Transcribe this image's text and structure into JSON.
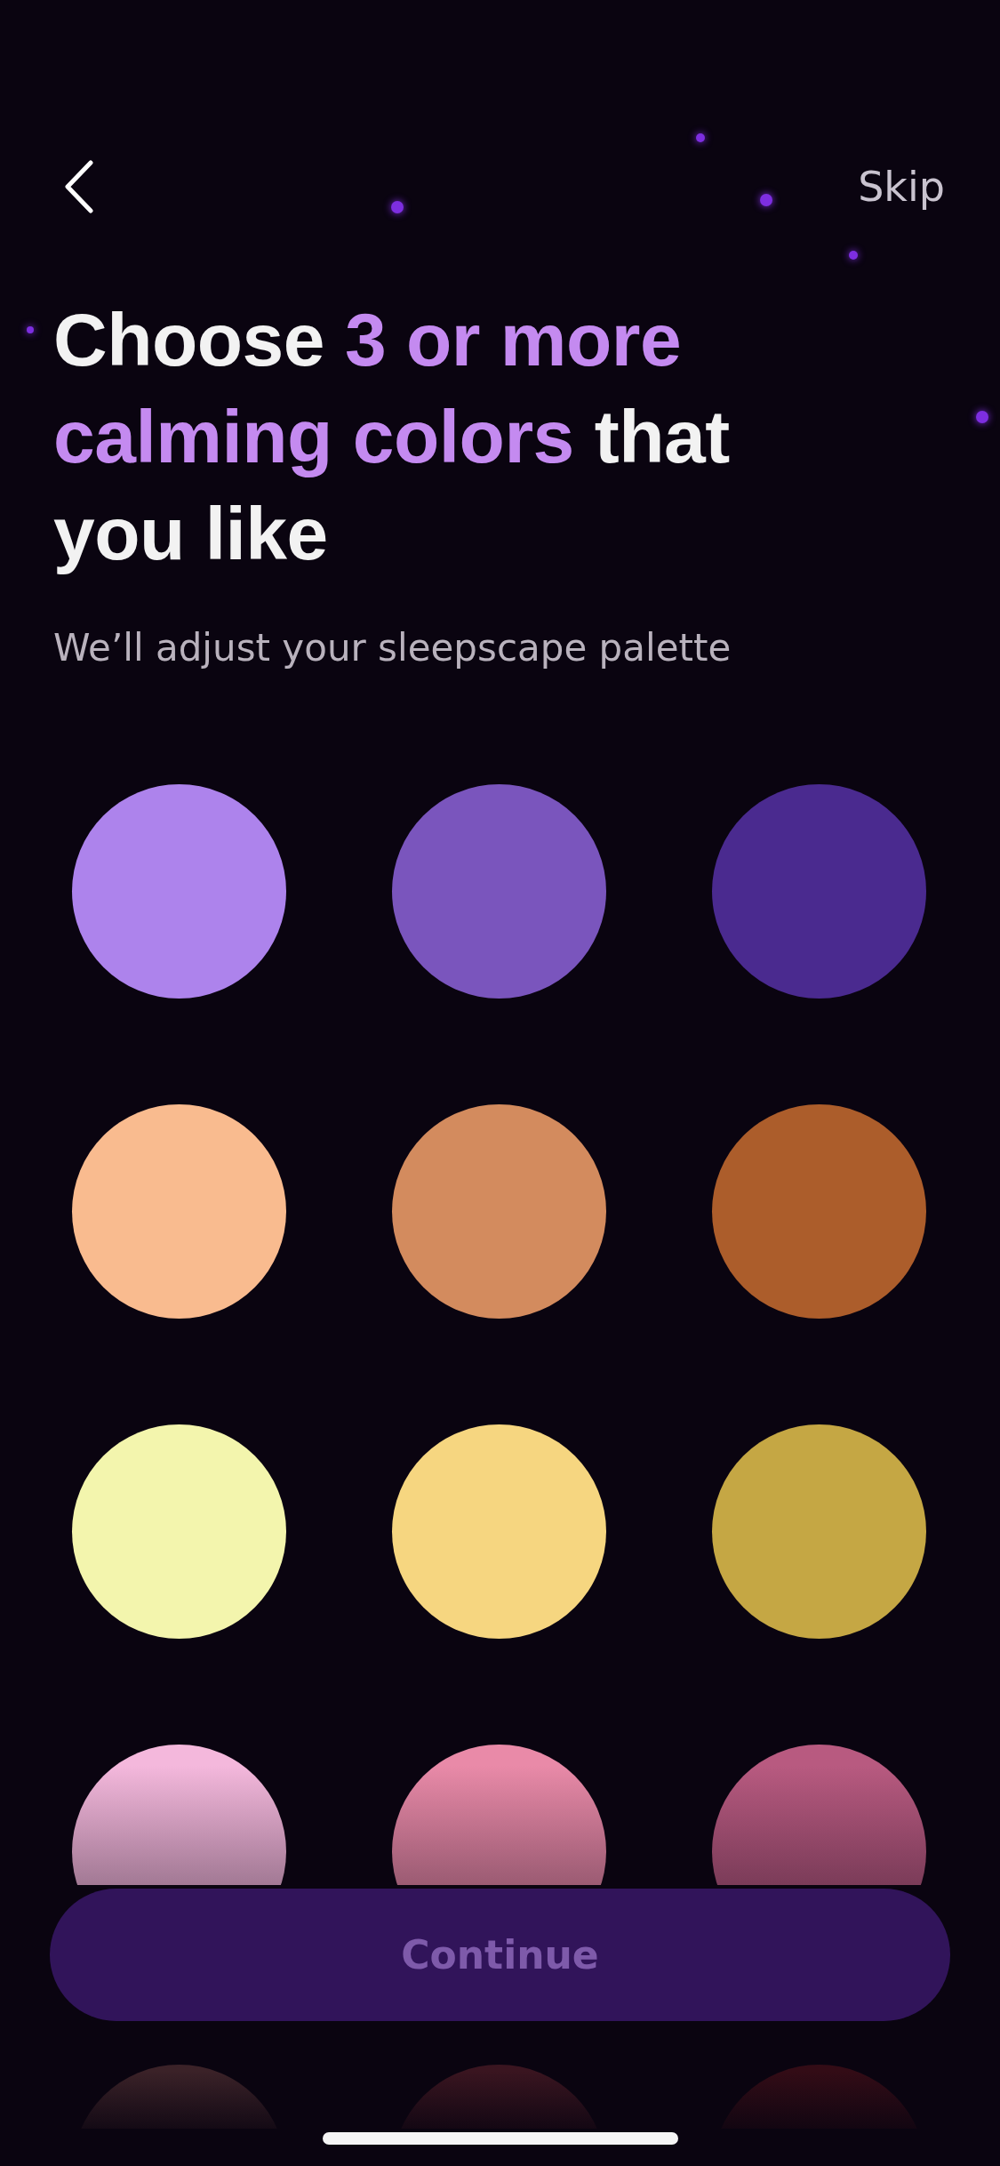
{
  "header": {
    "skip": "Skip"
  },
  "title": "Choose **3 or more calming colors** that you like",
  "subtitle": "We’ll adjust your sleepscape palette",
  "swatches": [
    {
      "color": "#ad83ec",
      "selected": false
    },
    {
      "color": "#7a55bd",
      "selected": false
    },
    {
      "color": "#4a2a8f",
      "selected": false
    },
    {
      "color": "#f9bb8f",
      "selected": false
    },
    {
      "color": "#d38b5e",
      "selected": false
    },
    {
      "color": "#ac5d2b",
      "selected": false
    },
    {
      "color": "#f3f5ad",
      "selected": false
    },
    {
      "color": "#f6d680",
      "selected": false
    },
    {
      "color": "#c5a744",
      "selected": false
    },
    {
      "color": "#f4b8dc",
      "selected": false
    },
    {
      "color": "#e98aa8",
      "selected": false
    },
    {
      "color": "#b85a80",
      "selected": false
    },
    {
      "color": "#3b2228",
      "selected": false
    },
    {
      "color": "#3a1520",
      "selected": false
    },
    {
      "color": "#330c16",
      "selected": false
    }
  ],
  "continue_button": {
    "label": "Continue",
    "disabled": true
  }
}
